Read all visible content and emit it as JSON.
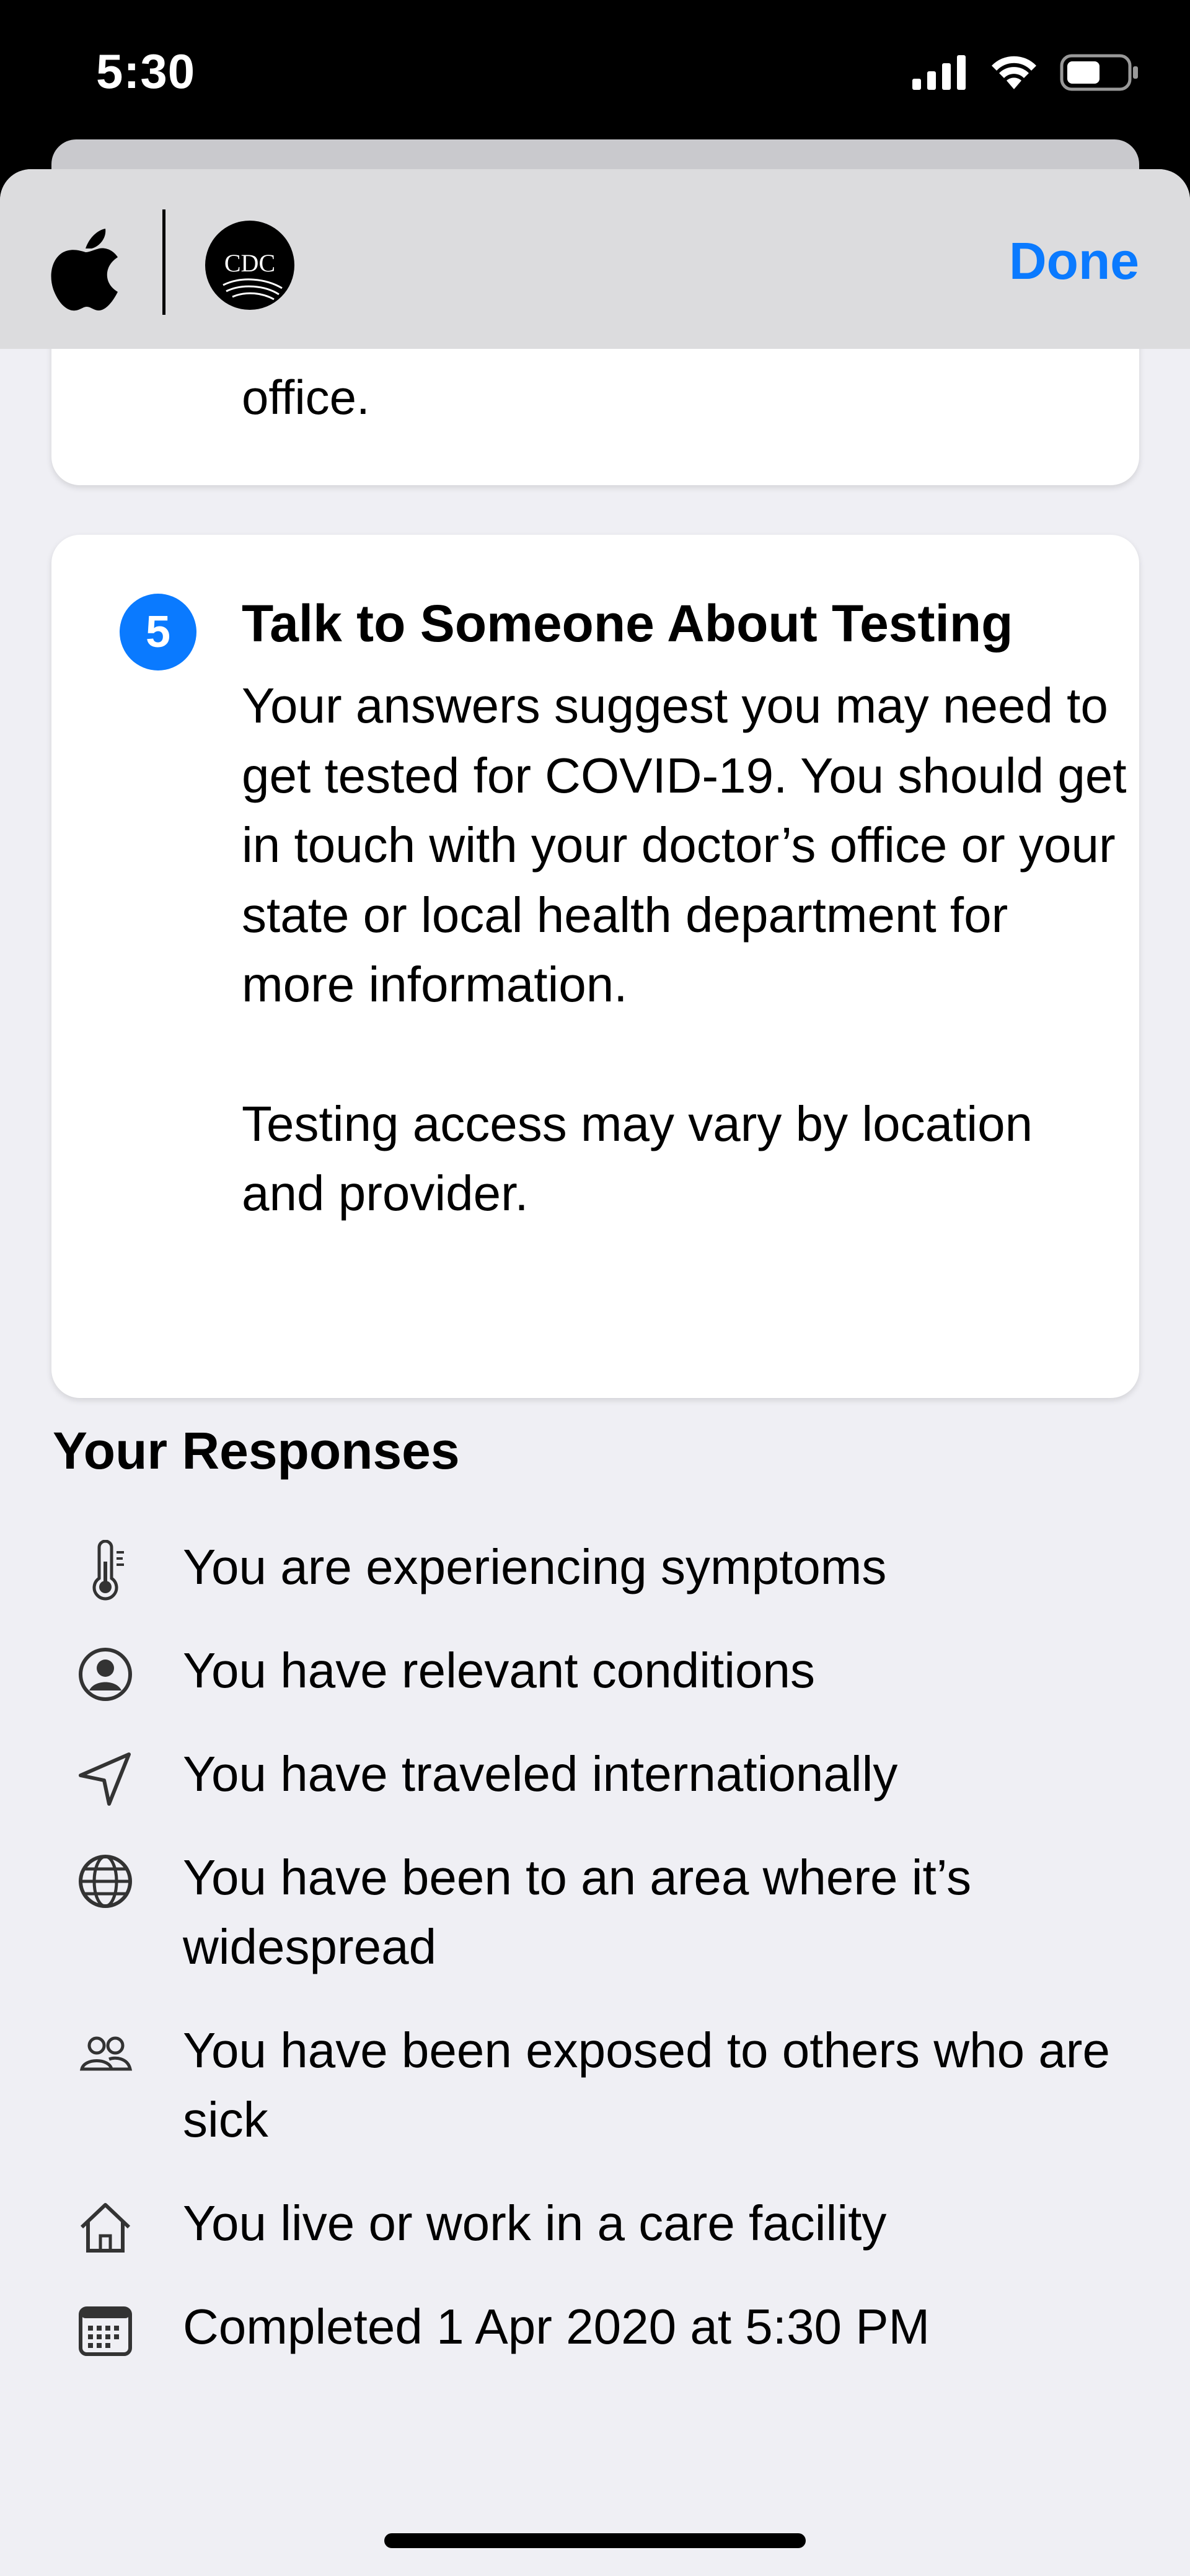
{
  "status": {
    "time": "5:30"
  },
  "header": {
    "done_label": "Done",
    "cdc_logo_text": "CDC"
  },
  "cards": {
    "previous_fragment": "office.",
    "testing": {
      "number": "5",
      "title": "Talk to Someone About Testing",
      "body_1": "Your answers suggest you may need to get tested for COVID-19. You should get in touch with your doctor’s office or your state or local health department for more information.",
      "body_2": "Testing access may vary by location and provider."
    }
  },
  "responses": {
    "title": "Your Responses",
    "items": [
      {
        "icon": "thermometer-icon",
        "text": "You are experiencing symptoms"
      },
      {
        "icon": "person-circle-icon",
        "text": "You have relevant conditions"
      },
      {
        "icon": "location-arrow-icon",
        "text": "You have traveled internationally"
      },
      {
        "icon": "globe-icon",
        "text": "You have been to an area where it’s widespread"
      },
      {
        "icon": "people-icon",
        "text": "You have been exposed to others who are sick"
      },
      {
        "icon": "house-icon",
        "text": "You live or work in a care facility"
      },
      {
        "icon": "calendar-icon",
        "text": "Completed 1 Apr 2020 at 5:30 PM"
      }
    ]
  },
  "colors": {
    "accent": "#0a7aff",
    "background": "#efeff4",
    "card": "#ffffff"
  }
}
